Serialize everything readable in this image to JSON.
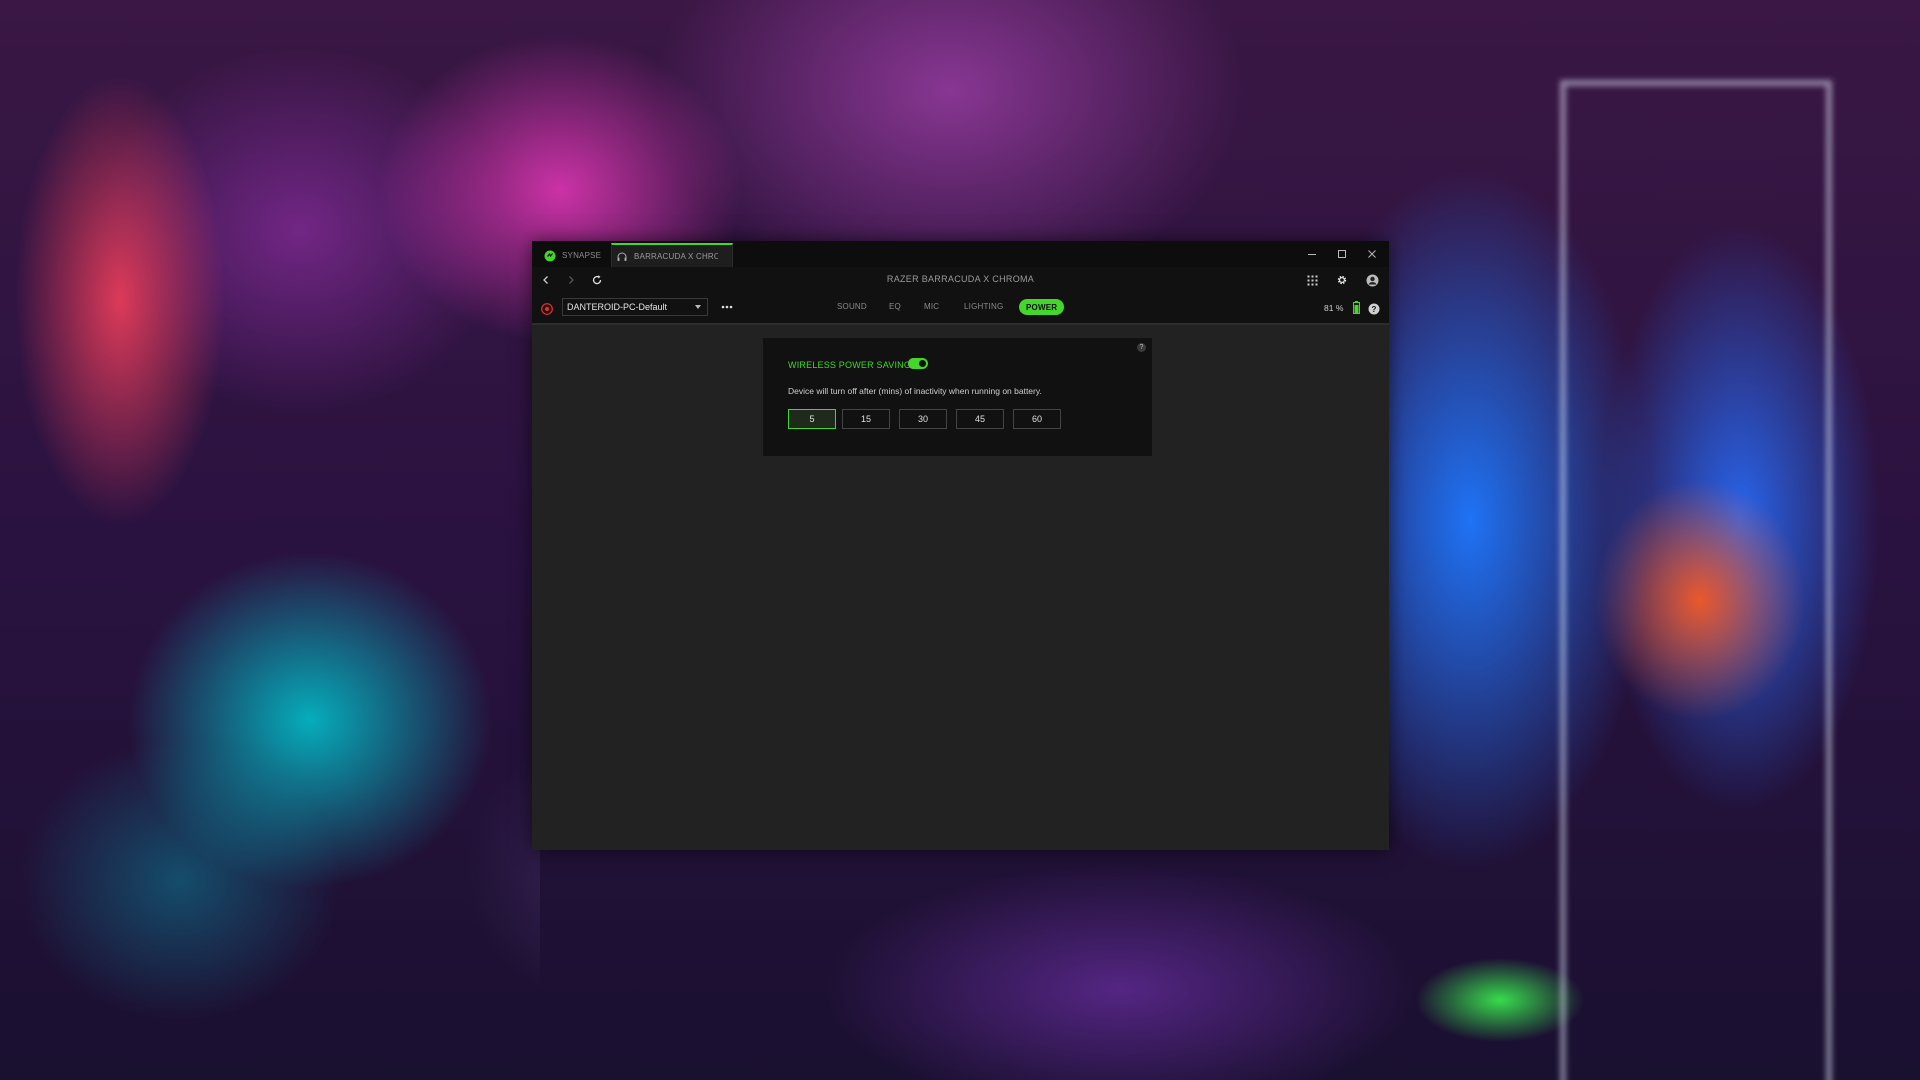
{
  "tabs": [
    {
      "label": "SYNAPSE",
      "icon": "razer-logo-icon"
    },
    {
      "label": "BARRACUDA X CHROMA",
      "icon": "headset-icon"
    }
  ],
  "window": {
    "title": "RAZER BARRACUDA X CHROMA"
  },
  "profile": {
    "selected": "DANTEROID-PC-Default"
  },
  "nav_tabs": [
    {
      "label": "SOUND"
    },
    {
      "label": "EQ"
    },
    {
      "label": "MIC"
    },
    {
      "label": "LIGHTING"
    },
    {
      "label": "POWER",
      "active": true
    }
  ],
  "battery": {
    "text": "81 %",
    "level": 0.81
  },
  "power": {
    "title": "WIRELESS POWER SAVING",
    "enabled": true,
    "description": "Device will turn off after (mins) of inactivity when running on battery.",
    "options": [
      "5",
      "15",
      "30",
      "45",
      "60"
    ],
    "selected": "5"
  },
  "colors": {
    "accent": "#44d62c",
    "window_bg": "#222222",
    "bar_bg": "#111111"
  }
}
